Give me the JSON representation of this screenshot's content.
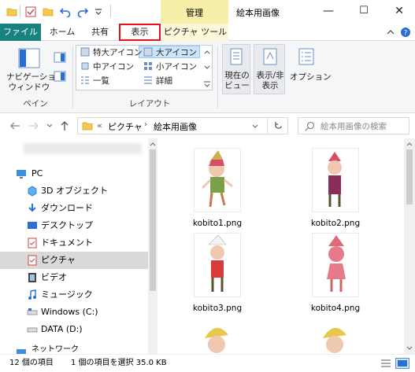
{
  "window": {
    "context_tab_title": "管理",
    "title": "絵本用画像",
    "minimize": "—",
    "maximize": "☐",
    "close": "✕"
  },
  "tabs": [
    {
      "label": "ファイル"
    },
    {
      "label": "ホーム"
    },
    {
      "label": "共有"
    },
    {
      "label": "表示"
    },
    {
      "label": "ピクチャ ツール"
    }
  ],
  "ribbon": {
    "nav_pane_label": "ナビゲーション\nウィンドウ",
    "pane_group": "ペイン",
    "layout_items": [
      "特大アイコン",
      "大アイコン",
      "中アイコン",
      "小アイコン",
      "一覧",
      "詳細"
    ],
    "layout_group": "レイアウト",
    "current_view": "現在の\nビュー",
    "show_hide": "表示/非\n表示",
    "options": "オプション"
  },
  "address": {
    "separator": "«",
    "crumbs": [
      "ピクチャ",
      "絵本用画像"
    ],
    "search_placeholder": "絵本用画像の検索"
  },
  "nav": {
    "items": [
      {
        "label": "PC",
        "icon": "pc-icon"
      },
      {
        "label": "3D オブジェクト",
        "icon": "cube-icon"
      },
      {
        "label": "ダウンロード",
        "icon": "download-icon"
      },
      {
        "label": "デスクトップ",
        "icon": "desktop-icon"
      },
      {
        "label": "ドキュメント",
        "icon": "document-icon"
      },
      {
        "label": "ピクチャ",
        "icon": "pictures-icon"
      },
      {
        "label": "ビデオ",
        "icon": "video-icon"
      },
      {
        "label": "ミュージック",
        "icon": "music-icon"
      },
      {
        "label": "Windows (C:)",
        "icon": "drive-icon"
      },
      {
        "label": "DATA (D:)",
        "icon": "drive-icon"
      },
      {
        "label": "ネットワーク",
        "icon": "network-icon"
      }
    ]
  },
  "files": [
    {
      "name": "kobito1.png"
    },
    {
      "name": "kobito2.png"
    },
    {
      "name": "kobito3.png"
    },
    {
      "name": "kobito4.png"
    }
  ],
  "status": {
    "count": "12 個の項目",
    "selection": "1 個の項目を選択  35.0 KB"
  },
  "colors": {
    "file_tab": "#19827e",
    "context_band": "#f7eeaa",
    "selected_nav": "#d9d9d9",
    "highlight_box": "#e8101a"
  }
}
